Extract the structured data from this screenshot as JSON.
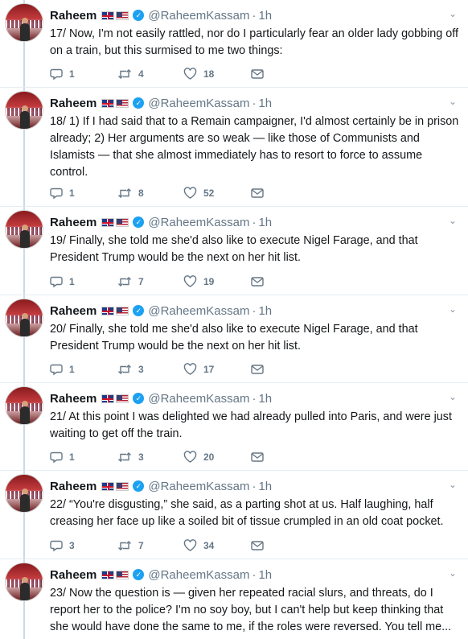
{
  "author": {
    "name": "Raheem",
    "handle": "@RaheemKassam",
    "verified_glyph": "✓",
    "separator": "·",
    "caret": "⌄"
  },
  "icons": {
    "reply": "speech-bubble-icon",
    "retweet": "retweet-icon",
    "like": "heart-icon",
    "dm": "envelope-icon",
    "accent": "#1da1f2",
    "muted": "#657786"
  },
  "tweets": [
    {
      "time": "1h",
      "text": "17/ Now, I'm not easily rattled, nor do I particularly fear an older lady gobbing off on a train, but this surmised to me two things:",
      "replies": "1",
      "retweets": "4",
      "likes": "18"
    },
    {
      "time": "1h",
      "text": "18/ 1) If I had said that to a Remain campaigner, I'd almost certainly be in prison already; 2) Her arguments are so weak — like those of Communists and Islamists — that she almost immediately has to resort to force to assume control.",
      "replies": "1",
      "retweets": "8",
      "likes": "52"
    },
    {
      "time": "1h",
      "text": "19/ Finally, she told me she'd also like to execute Nigel Farage, and that President Trump would be the next on her hit list.",
      "replies": "1",
      "retweets": "7",
      "likes": "19"
    },
    {
      "time": "1h",
      "text": "20/ Finally, she told me she'd also like to execute Nigel Farage, and that President Trump would be the next on her hit list.",
      "replies": "1",
      "retweets": "3",
      "likes": "17"
    },
    {
      "time": "1h",
      "text": "21/ At this point I was delighted we had already pulled into Paris, and were just waiting to get off the train.",
      "replies": "1",
      "retweets": "3",
      "likes": "20"
    },
    {
      "time": "1h",
      "text": "22/ “You're disgusting,” she said, as a parting shot at us. Half laughing, half creasing her face up like a soiled bit of tissue crumpled in an old coat pocket.",
      "replies": "3",
      "retweets": "7",
      "likes": "34"
    },
    {
      "time": "1h",
      "text": "23/ Now the question is — given her repeated racial slurs, and threats, do I report her to the police? I'm no soy boy, but I can't help but keep thinking that she would have done the same to me, if the roles were reversed. You tell me...",
      "replies": "",
      "retweets": "",
      "likes": ""
    }
  ]
}
